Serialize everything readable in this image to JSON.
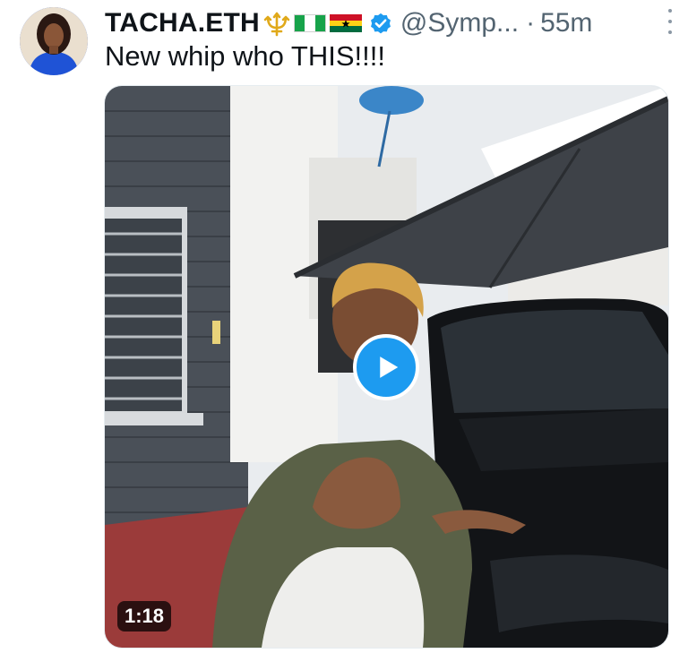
{
  "tweet": {
    "display_name": "TACHA.ETH",
    "name_emojis": [
      "trident-emoji",
      "nigeria-flag-emoji",
      "ghana-flag-emoji"
    ],
    "handle": "@Symp...",
    "separator": "·",
    "time": "55m",
    "text": "New whip who THIS!!!!"
  },
  "media": {
    "type": "video",
    "duration": "1:18",
    "play_icon": "play-icon"
  },
  "colors": {
    "accent": "#1d9bf0",
    "text_primary": "#0f1419",
    "text_secondary": "#536471"
  }
}
